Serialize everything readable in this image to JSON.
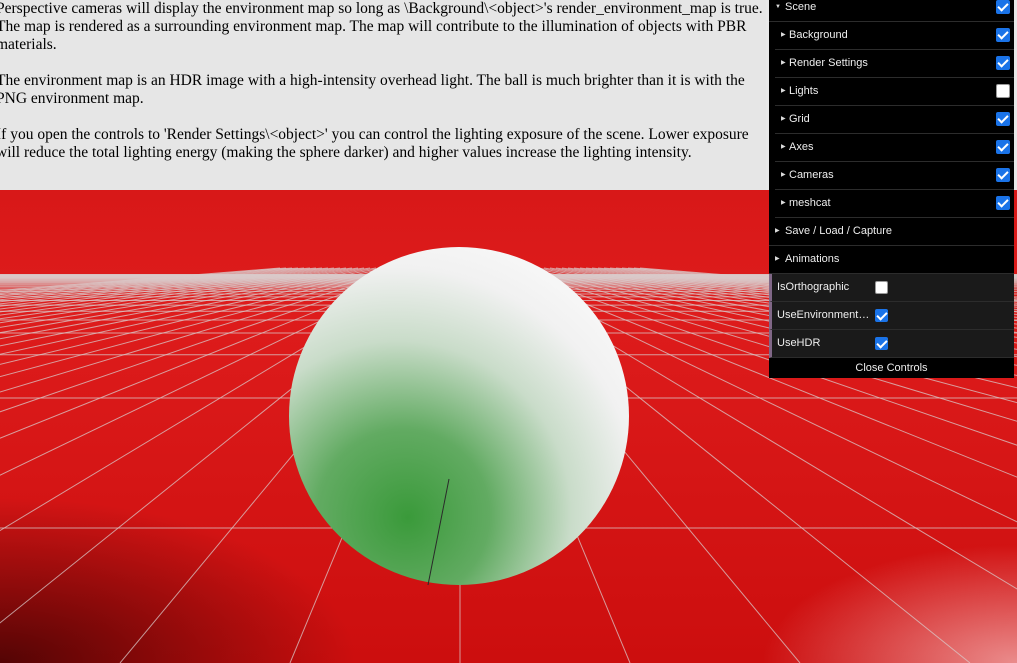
{
  "info": {
    "paragraphs": [
      "Perspective cameras will display the environment map so long as \\Background\\<object>'s render_environment_map is true. The map is rendered as a surrounding environment map. The map will contribute to the illumination of objects with PBR materials.",
      "The environment map is an HDR image with a high-intensity overhead light. The ball is much brighter than it is with the PNG environment map.",
      "If you open the controls to 'Render Settings\\<object>' you can control the lighting exposure of the scene. Lower exposure will reduce the total lighting energy (making the sphere darker) and higher values increase the lighting intensity."
    ]
  },
  "gui": {
    "scene": {
      "label": "Scene",
      "checked": true
    },
    "scene_children": [
      {
        "label": "Background",
        "checked": true
      },
      {
        "label": "Render Settings",
        "checked": true
      },
      {
        "label": "Lights",
        "checked": false
      },
      {
        "label": "Grid",
        "checked": true
      },
      {
        "label": "Axes",
        "checked": true
      },
      {
        "label": "Cameras",
        "checked": true
      },
      {
        "label": "meshcat",
        "checked": true
      }
    ],
    "folders": [
      {
        "label": "Save / Load / Capture"
      },
      {
        "label": "Animations"
      }
    ],
    "properties": [
      {
        "label": "IsOrthographic",
        "checked": false
      },
      {
        "label": "UseEnvironmentMap",
        "checked": true
      },
      {
        "label": "UseHDR",
        "checked": true
      }
    ],
    "close_label": "Close Controls"
  },
  "colors": {
    "background_red": "#d40f10",
    "sphere_top": "#f5f5f5",
    "sphere_green": "#3f9e3f",
    "grid_line": "#d8d8d8"
  }
}
